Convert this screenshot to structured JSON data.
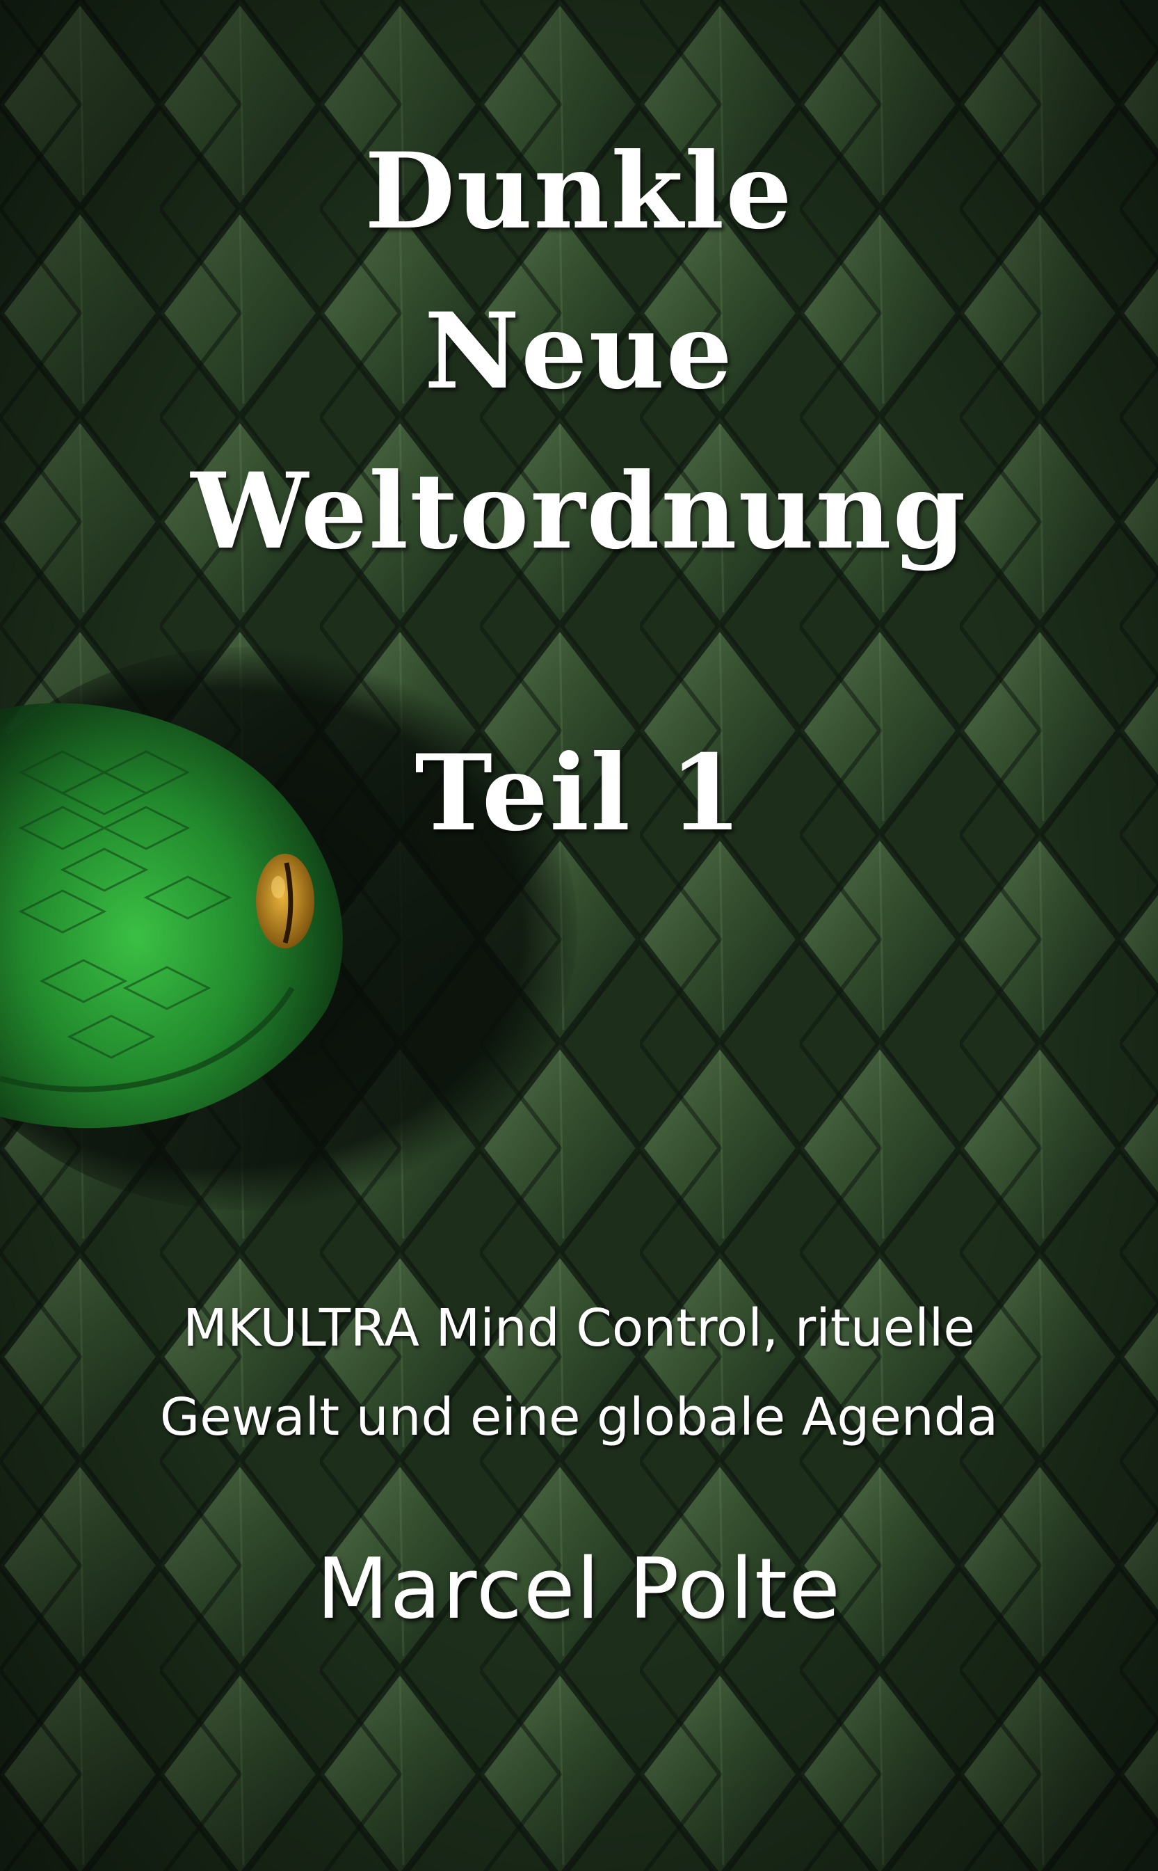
{
  "cover": {
    "title_lines": [
      "Dunkle",
      "Neue",
      "Weltordnung"
    ],
    "part": "Teil 1",
    "subtitle_lines": [
      "MKULTRA Mind Control, rituelle",
      "Gewalt und eine globale Agenda"
    ],
    "author": "Marcel Polte"
  },
  "colors": {
    "scale_dark": "#16241a",
    "scale_mid": "#2e4429",
    "scale_light": "#4f6a47",
    "snake_green": "#2fa33a",
    "snake_eye": "#c98a1e",
    "text": "#ffffff"
  }
}
